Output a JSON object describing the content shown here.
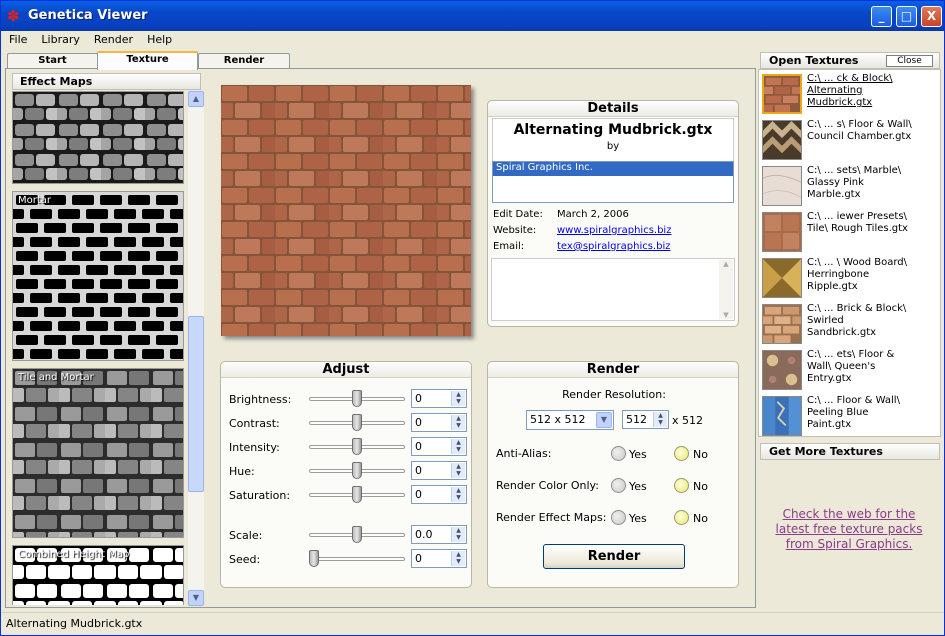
{
  "window": {
    "title": "Genetica Viewer",
    "min": "_",
    "max": "□",
    "close": "X"
  },
  "menu": [
    "File",
    "Library",
    "Render",
    "Help"
  ],
  "tabs": [
    "Start",
    "Texture",
    "Render"
  ],
  "effect_maps": {
    "header": "Effect Maps",
    "items": [
      {
        "label": ""
      },
      {
        "label": "Mortar"
      },
      {
        "label": "Tile and Mortar"
      },
      {
        "label": "Combined Height Map"
      }
    ]
  },
  "details": {
    "header": "Details",
    "name": "Alternating Mudbrick.gtx",
    "by": "by",
    "author": "Spiral Graphics Inc.",
    "edit_date_label": "Edit Date:",
    "edit_date": "March 2, 2006",
    "website_label": "Website:",
    "website": "www.spiralgraphics.biz",
    "email_label": "Email:",
    "email": "tex@spiralgraphics.biz"
  },
  "adjust": {
    "header": "Adjust",
    "rows": [
      {
        "label": "Brightness:",
        "value": "0",
        "level": 0.5
      },
      {
        "label": "Contrast:",
        "value": "0",
        "level": 0.5
      },
      {
        "label": "Intensity:",
        "value": "0",
        "level": 0.5
      },
      {
        "label": "Hue:",
        "value": "0",
        "level": 0.5
      },
      {
        "label": "Saturation:",
        "value": "0",
        "level": 0.5
      },
      {
        "label": "Scale:",
        "value": "0.0",
        "level": 0.5
      },
      {
        "label": "Seed:",
        "value": "0",
        "level": 0.0
      }
    ]
  },
  "render": {
    "header": "Render",
    "resolution_label": "Render Resolution:",
    "resolution_select": "512 x 512",
    "resolution_custom": "512",
    "resolution_suffix": "x 512",
    "options": [
      {
        "label": "Anti-Alias:",
        "yes": "Yes",
        "no": "No",
        "selected": "No"
      },
      {
        "label": "Render Color Only:",
        "yes": "Yes",
        "no": "No",
        "selected": "No"
      },
      {
        "label": "Render Effect Maps:",
        "yes": "Yes",
        "no": "No",
        "selected": "No"
      }
    ],
    "button": "Render"
  },
  "open_textures": {
    "header": "Open Textures",
    "close": "Close",
    "items": [
      {
        "l1": "C:\\ ... ck & Block\\",
        "l2": "Alternating",
        "l3": "Mudbrick.gtx",
        "thumb": "brick"
      },
      {
        "l1": "C:\\ ... s\\ Floor & Wall\\",
        "l2": "Council Chamber.gtx",
        "l3": "",
        "thumb": "chevron"
      },
      {
        "l1": "C:\\ ... sets\\ Marble\\",
        "l2": "Glassy Pink",
        "l3": "Marble.gtx",
        "thumb": "marble"
      },
      {
        "l1": "C:\\ ... iewer Presets\\",
        "l2": "Tile\\ Rough Tiles.gtx",
        "l3": "",
        "thumb": "tiles"
      },
      {
        "l1": "C:\\ ... \\ Wood Board\\",
        "l2": "Herringbone",
        "l3": "Ripple.gtx",
        "thumb": "wood"
      },
      {
        "l1": "C:\\ ... Brick & Block\\",
        "l2": "Swirled",
        "l3": "Sandbrick.gtx",
        "thumb": "sandbrick"
      },
      {
        "l1": "C:\\ ... ets\\ Floor &",
        "l2": "Wall\\ Queen's",
        "l3": "Entry.gtx",
        "thumb": "queen"
      },
      {
        "l1": "C:\\ ... Floor & Wall\\",
        "l2": "Peeling Blue",
        "l3": "Paint.gtx",
        "thumb": "blue"
      }
    ]
  },
  "get_more": {
    "header": "Get More Textures",
    "link": "Check the web for the latest free texture packs from Spiral Graphics."
  },
  "status": "Alternating Mudbrick.gtx"
}
